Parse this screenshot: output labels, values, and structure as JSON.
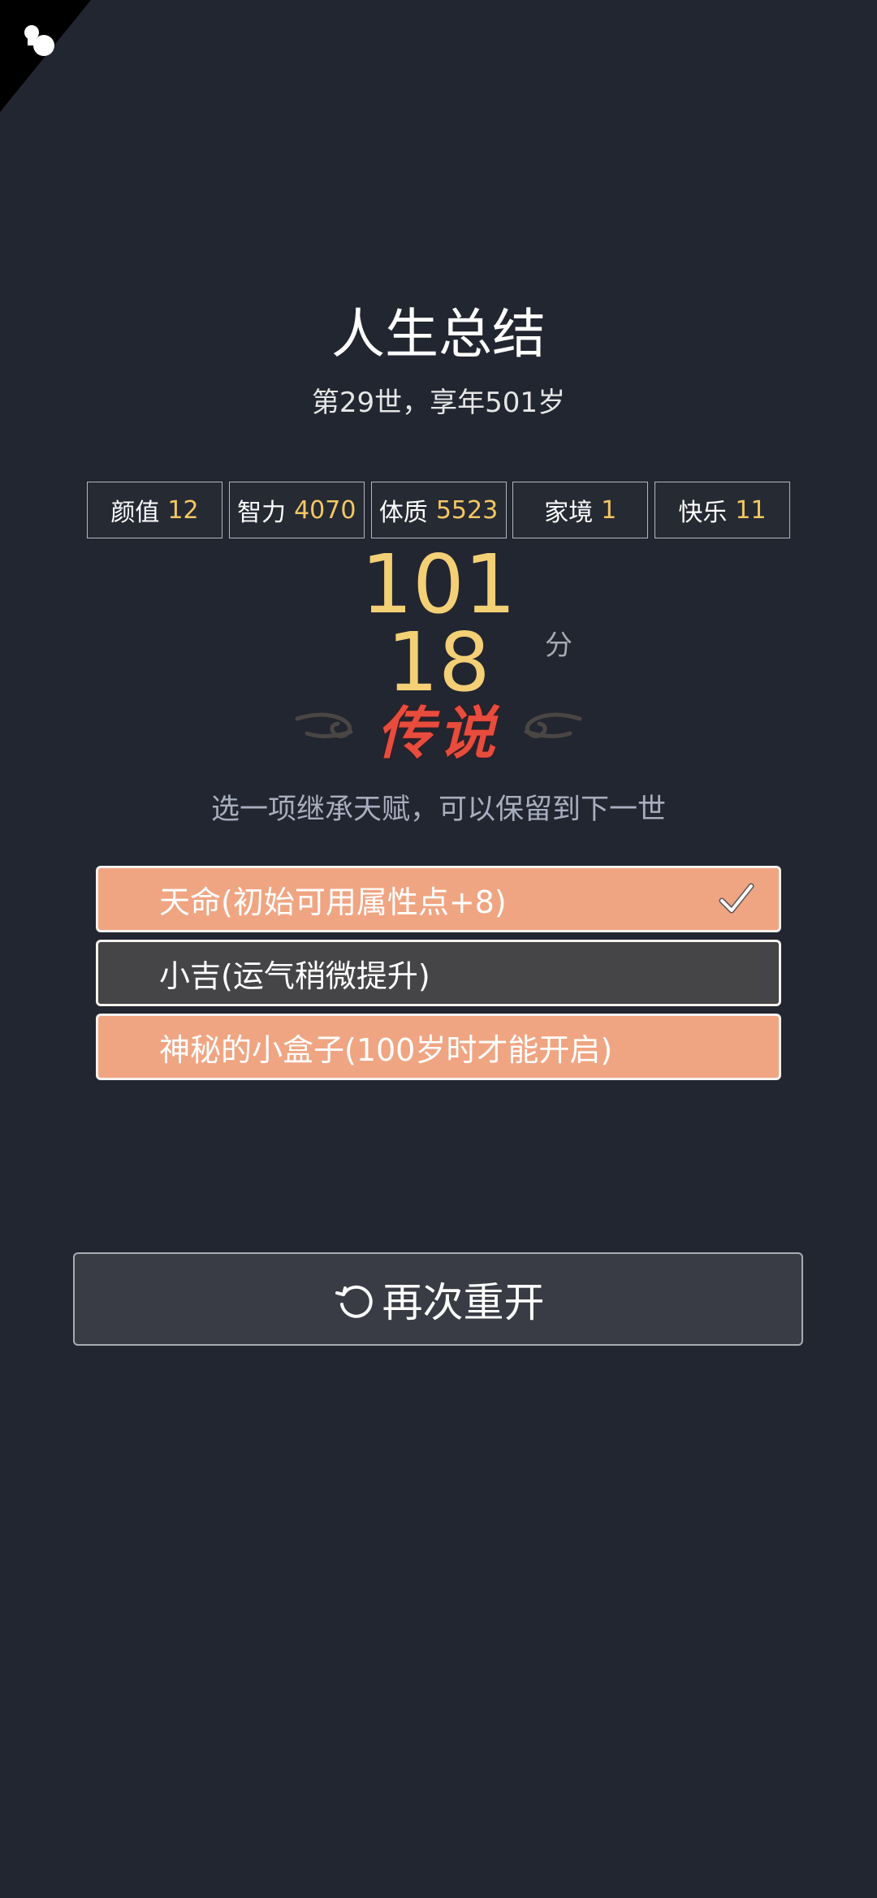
{
  "summary": {
    "title": "人生总结",
    "subtitle": "第29世，享年501岁"
  },
  "stats": [
    {
      "label": "颜值",
      "value": "12"
    },
    {
      "label": "智力",
      "value": "4070"
    },
    {
      "label": "体质",
      "value": "5523"
    },
    {
      "label": "家境",
      "value": "1"
    },
    {
      "label": "快乐",
      "value": "11"
    }
  ],
  "score": {
    "value": "10118",
    "unit": "分"
  },
  "rank": {
    "label": "传说"
  },
  "inherit": {
    "hint": "选一项继承天赋，可以保留到下一世",
    "options": [
      {
        "label": "天命(初始可用属性点+8)",
        "selected": true
      },
      {
        "label": "小吉(运气稍微提升)",
        "selected": false
      },
      {
        "label": "神秘的小盒子(100岁时才能开启)",
        "selected": false
      }
    ]
  },
  "restart": {
    "label": "再次重开"
  },
  "colors": {
    "background": "#222630",
    "accent_gold": "#f3c763",
    "option_orange": "#f0a582",
    "option_dark": "#454547",
    "rank_red": "#e84c3d"
  }
}
